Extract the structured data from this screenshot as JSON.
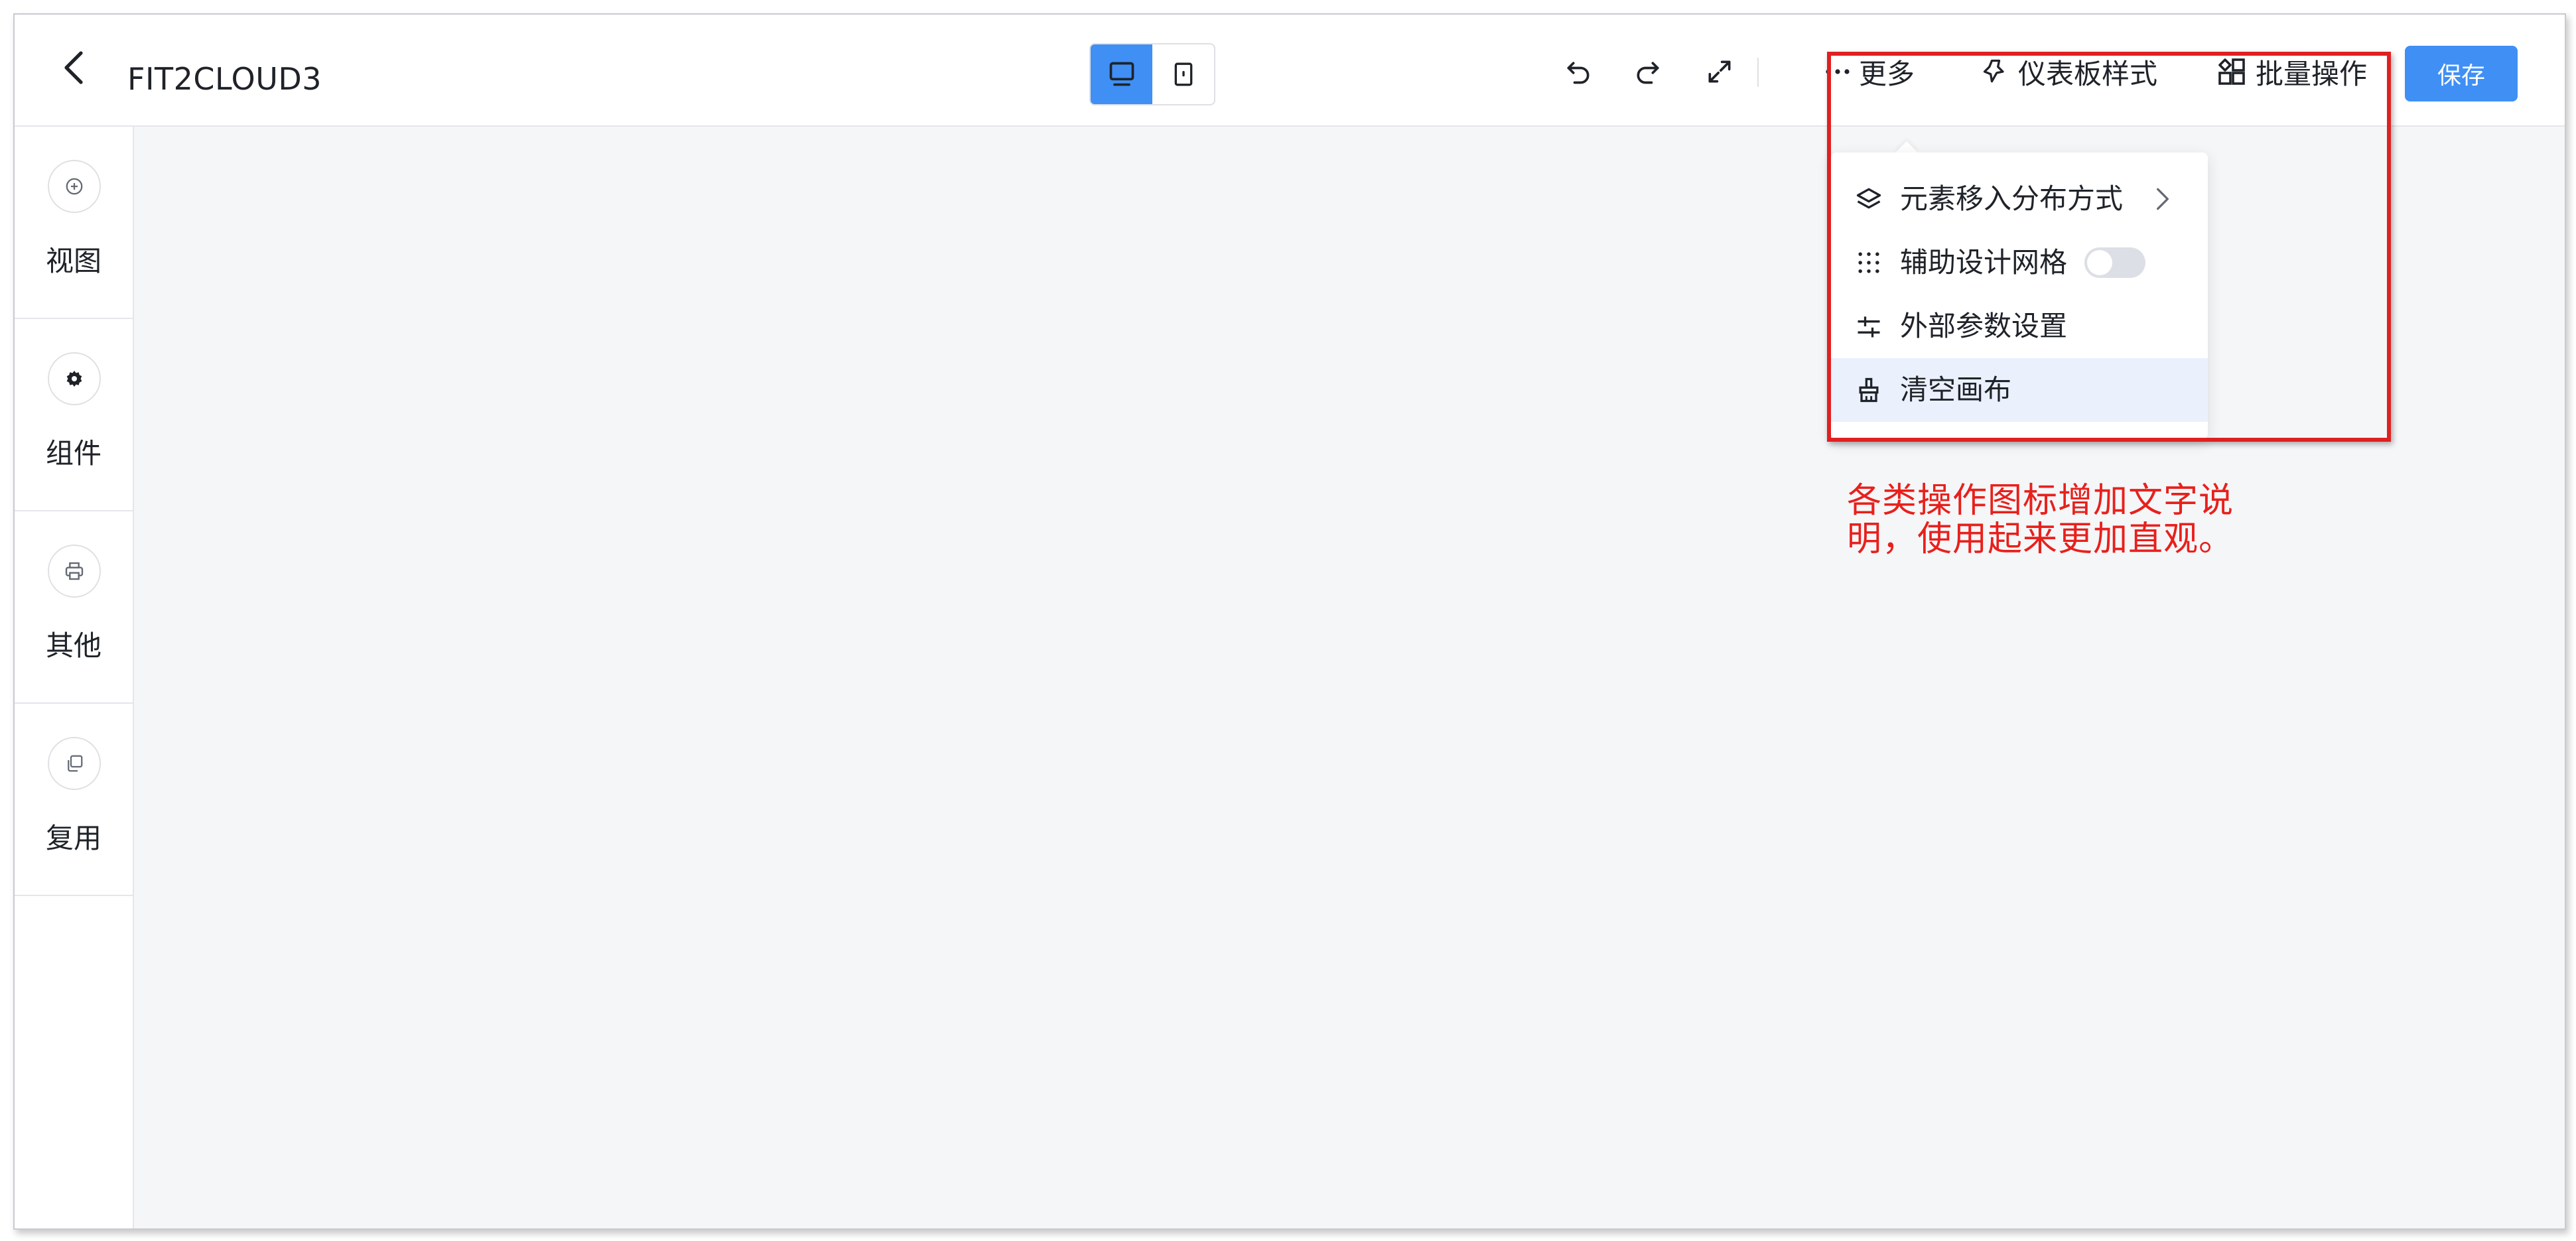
{
  "header": {
    "title": "FIT2CLOUD3",
    "more_label": "更多",
    "dashboard_style_label": "仪表板样式",
    "batch_label": "批量操作",
    "save_label": "保存"
  },
  "sidebar": {
    "items": [
      {
        "label": "视图"
      },
      {
        "label": "组件"
      },
      {
        "label": "其他"
      },
      {
        "label": "复用"
      }
    ]
  },
  "dropdown": {
    "items": [
      {
        "label": "元素移入分布方式"
      },
      {
        "label": "辅助设计网格",
        "toggle_on": false
      },
      {
        "label": "外部参数设置"
      },
      {
        "label": "清空画布"
      }
    ]
  },
  "annotation": {
    "text": "各类操作图标增加文字说明，使用起来更加直观。",
    "color": "#e8201c"
  },
  "colors": {
    "accent": "#3f8ff5",
    "highlight": "#e02020"
  }
}
